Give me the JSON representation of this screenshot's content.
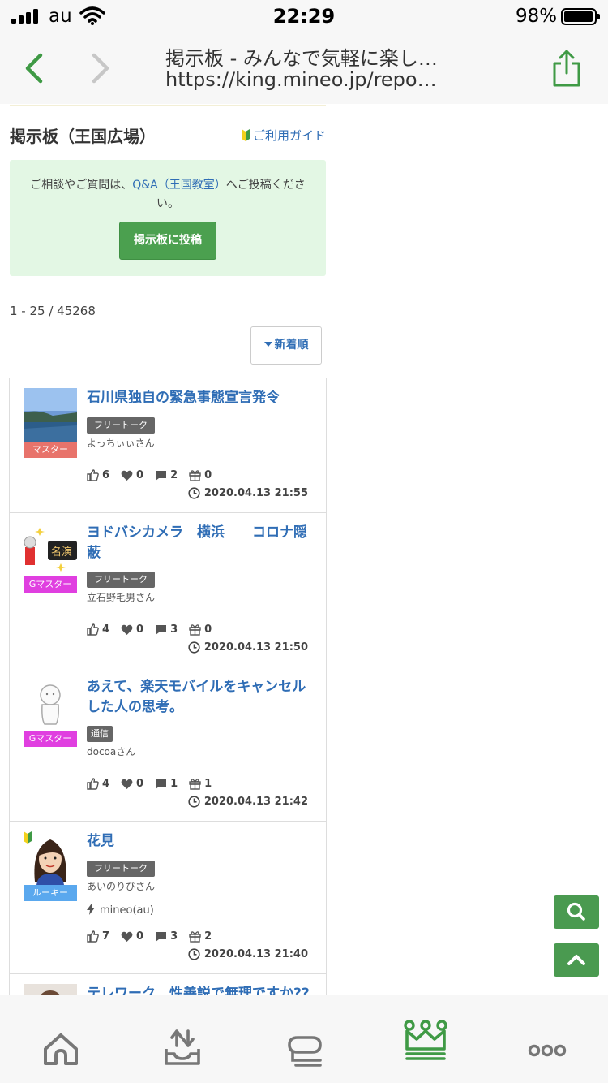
{
  "status_bar": {
    "carrier": "au",
    "time": "22:29",
    "battery_percent": "98%",
    "battery_level": 0.98
  },
  "browser": {
    "page_title": "掲示板 - みんなで気軽に楽し…",
    "url": "https://king.mineo.jp/repo…",
    "back_icon": "chevron-left-icon",
    "forward_icon": "chevron-right-icon",
    "share_icon": "share-icon"
  },
  "page": {
    "title": "掲示板（王国広場）",
    "guide_link": "ご利用ガイド",
    "notice_prefix": "ご相談やご質問は、",
    "notice_link": "Q&A（王国教室）",
    "notice_suffix": "へご投稿ください。",
    "post_button": "掲示板に投稿",
    "count": "1 - 25 / 45268",
    "sort_label": "新着順"
  },
  "posts": [
    {
      "title": "石川県独自の緊急事態宣言発令",
      "rank": "マスター",
      "rank_color": "#e8736b",
      "tag": "フリートーク",
      "author": "よっちぃぃさん",
      "device": "",
      "likes": "6",
      "hearts": "0",
      "comments": "2",
      "gifts": "0",
      "date": "2020.04.13 21:55"
    },
    {
      "title": "ヨドバシカメラ　横浜　　コロナ隠蔽",
      "rank": "Gマスター",
      "rank_color": "#e03fe0",
      "tag": "フリートーク",
      "author": "立石野毛男さん",
      "device": "",
      "likes": "4",
      "hearts": "0",
      "comments": "3",
      "gifts": "0",
      "date": "2020.04.13 21:50"
    },
    {
      "title": "あえて、楽天モバイルをキャンセルした人の思考。",
      "rank": "Gマスター",
      "rank_color": "#e03fe0",
      "tag": "通信",
      "author": "docoaさん",
      "device": "",
      "likes": "4",
      "hearts": "0",
      "comments": "1",
      "gifts": "1",
      "date": "2020.04.13 21:42"
    },
    {
      "title": "花見",
      "rank": "ルーキー",
      "rank_color": "#5aa8ee",
      "tag": "フリートーク",
      "author": "あいのりぴさん",
      "device": "mineo(au)",
      "likes": "7",
      "hearts": "0",
      "comments": "3",
      "gifts": "2",
      "date": "2020.04.13 21:40"
    },
    {
      "title": "テレワーク　性善説で無理ですか??",
      "rank": "",
      "rank_color": "",
      "tag": "",
      "author": "",
      "device": "",
      "likes": "",
      "hearts": "",
      "comments": "",
      "gifts": "",
      "date": ""
    }
  ],
  "fabs": {
    "search_icon": "search-icon",
    "scroll_top_icon": "chevron-up-icon"
  },
  "tab_bar": {
    "items": [
      "home-icon",
      "inbox-icon",
      "chat-icon",
      "crown-icon",
      "more-icon"
    ],
    "active": "crown-icon",
    "active_color": "#3f9a45"
  }
}
